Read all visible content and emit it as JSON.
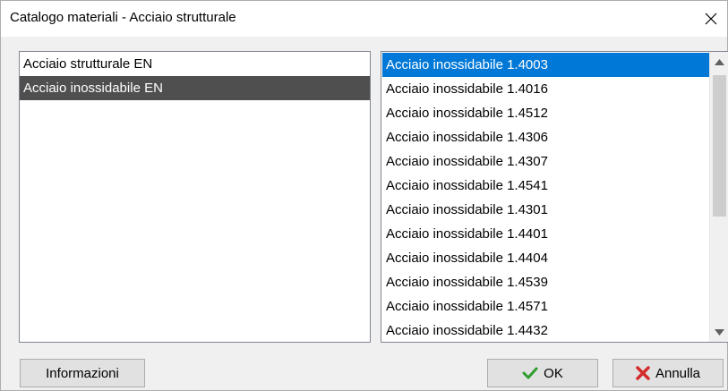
{
  "window": {
    "title": "Catalogo materiali  - Acciaio strutturale",
    "close_icon": "close-icon"
  },
  "categories": [
    {
      "label": "Acciaio strutturale  EN",
      "selected": false
    },
    {
      "label": "Acciaio inossidabile  EN",
      "selected": true
    }
  ],
  "materials": [
    {
      "label": "Acciaio inossidabile  1.4003",
      "selected": true
    },
    {
      "label": "Acciaio inossidabile  1.4016",
      "selected": false
    },
    {
      "label": "Acciaio inossidabile  1.4512",
      "selected": false
    },
    {
      "label": "Acciaio inossidabile  1.4306",
      "selected": false
    },
    {
      "label": "Acciaio inossidabile  1.4307",
      "selected": false
    },
    {
      "label": "Acciaio inossidabile  1.4541",
      "selected": false
    },
    {
      "label": "Acciaio inossidabile  1.4301",
      "selected": false
    },
    {
      "label": "Acciaio inossidabile  1.4401",
      "selected": false
    },
    {
      "label": "Acciaio inossidabile  1.4404",
      "selected": false
    },
    {
      "label": "Acciaio inossidabile  1.4539",
      "selected": false
    },
    {
      "label": "Acciaio inossidabile  1.4571",
      "selected": false
    },
    {
      "label": "Acciaio inossidabile  1.4432",
      "selected": false
    }
  ],
  "buttons": {
    "info_label": "Informazioni",
    "ok_label": "OK",
    "cancel_label": "Annulla"
  },
  "colors": {
    "selection_blue": "#0078d7",
    "selection_gray": "#4f4f4f",
    "ok_check": "#2e9e2e",
    "cancel_x": "#d42b2b"
  }
}
